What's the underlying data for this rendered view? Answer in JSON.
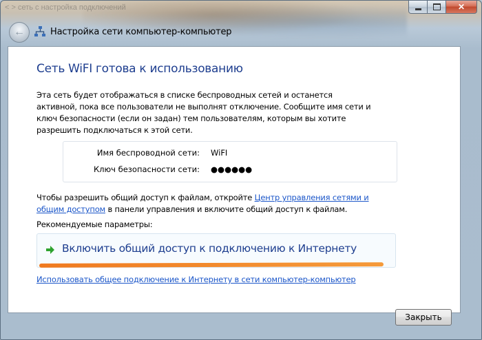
{
  "window": {
    "background_title": "< > сеть с настройка подключений",
    "title": "Настройка сети компьютер-компьютер",
    "caption": {
      "close_glyph": "✕"
    }
  },
  "icons": {
    "back": "back-arrow-icon",
    "network": "network-icon",
    "command_arrow": "green-arrow-icon"
  },
  "content": {
    "heading": "Сеть WiFI готова к использованию",
    "description": "Эта сеть будет отображаться в списке беспроводных сетей и останется активной, пока все пользователи не выполнят отключение. Сообщите имя сети и ключ безопасности (если он задан) тем пользователям, которым вы хотите разрешить подключаться к этой сети.",
    "network_name_label": "Имя беспроводной сети:",
    "network_name_value": "WiFI",
    "security_key_label": "Ключ безопасности сети:",
    "security_key_value": "●●●●●●",
    "sharing_text_before": "Чтобы разрешить общий доступ к файлам, откройте ",
    "sharing_link": "Центр управления сетями и общим доступом",
    "sharing_text_after": " в панели управления и включите общий доступ к файлам.",
    "recommended_label": "Рекомендуемые параметры:",
    "command_label": "Включить общий доступ к подключению к Интернету",
    "bottom_link": "Использовать общее подключение к Интернету в сети компьютер-компьютер"
  },
  "buttons": {
    "close": "Закрыть"
  },
  "colors": {
    "heading": "#1e3e8f",
    "link": "#1b56c9",
    "highlight_stroke": "#f07a1f"
  }
}
